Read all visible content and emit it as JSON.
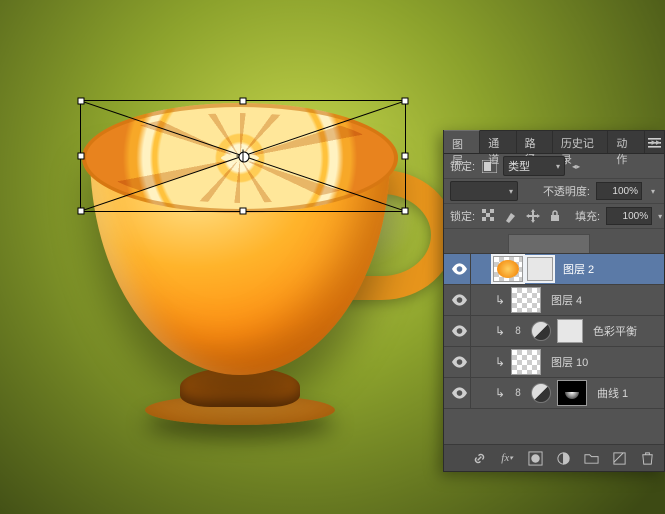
{
  "panel": {
    "tabs": [
      "图层",
      "通道",
      "路径",
      "历史记录",
      "动作"
    ],
    "active_tab_index": 0,
    "kind_row": {
      "label": "锁定:",
      "dropdown": "类型"
    },
    "opacity_row": {
      "label": "不透明度:",
      "value": "100%"
    },
    "lock_row": {
      "label": "锁定:",
      "fill_label": "填充:",
      "fill_value": "100%"
    },
    "layers": [
      {
        "name": "图层 2",
        "selected": true,
        "clip": false,
        "adj": false,
        "thumb": "checker orange",
        "mask": true,
        "link8": false
      },
      {
        "name": "图层 4",
        "selected": false,
        "clip": true,
        "adj": false,
        "thumb": "checker",
        "mask": false,
        "link8": false
      },
      {
        "name": "色彩平衡",
        "selected": false,
        "clip": true,
        "adj": true,
        "thumb": "",
        "mask": "flat-white",
        "link8": true
      },
      {
        "name": "图层 10",
        "selected": false,
        "clip": true,
        "adj": false,
        "thumb": "checker",
        "mask": false,
        "link8": false
      },
      {
        "name": "曲线 1",
        "selected": false,
        "clip": true,
        "adj": true,
        "thumb": "",
        "mask": "black",
        "link8": true
      }
    ],
    "footer_icons": [
      "link",
      "fx",
      "mask",
      "adjust",
      "group",
      "new",
      "trash"
    ]
  }
}
